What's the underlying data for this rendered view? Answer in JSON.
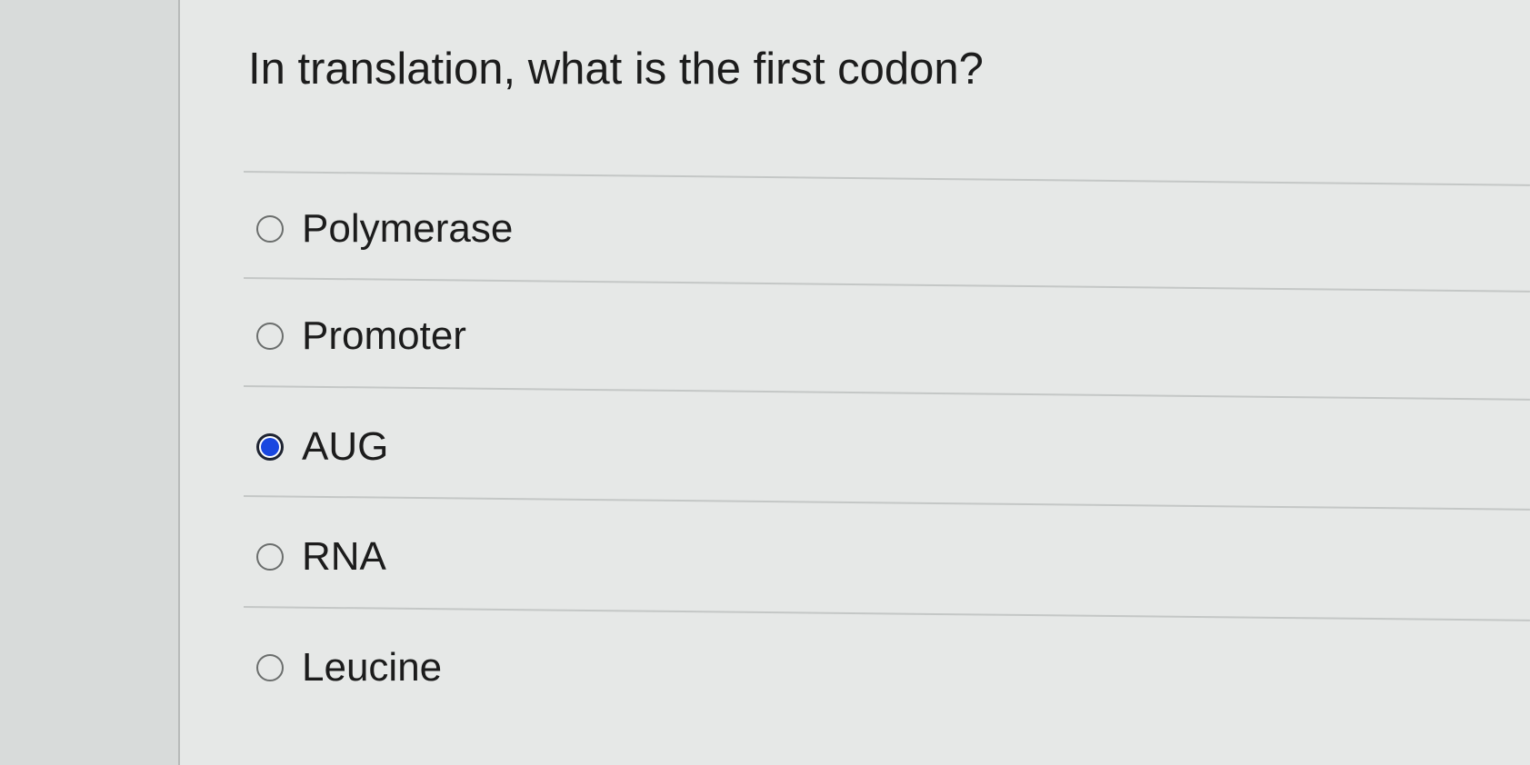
{
  "question": {
    "text": "In translation, what is the first codon?"
  },
  "options": [
    {
      "label": "Polymerase",
      "selected": false
    },
    {
      "label": "Promoter",
      "selected": false
    },
    {
      "label": "AUG",
      "selected": true
    },
    {
      "label": "RNA",
      "selected": false
    },
    {
      "label": "Leucine",
      "selected": false
    }
  ],
  "colors": {
    "selected_radio": "#1a47e0",
    "text": "#1c1c1c",
    "background": "#e6e8e7"
  }
}
